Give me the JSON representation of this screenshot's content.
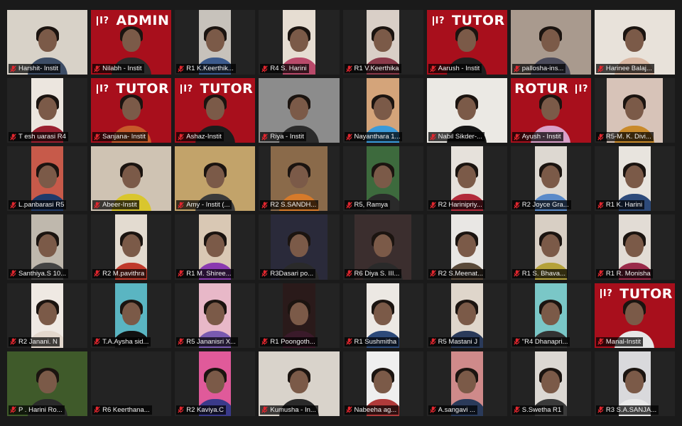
{
  "app": {
    "view": "gallery"
  },
  "colors": {
    "background": "#1a1a1a",
    "tile": "#232323",
    "brand_red": "#a80f1c",
    "mic_muted": "#e0262e"
  },
  "icons": {
    "name_badge_icon": "muted-mic-icon"
  },
  "participants": [
    {
      "name": "Harshit- Instit",
      "banner": "",
      "bg": "#d8d2c8",
      "shirt": "#3d4d66",
      "video": "full"
    },
    {
      "name": "Nilabh - Instit",
      "banner": "ADMIN",
      "bg": "#a80f1c",
      "shirt": "#2a2a2a",
      "video": "full"
    },
    {
      "name": "R1 K.Keerthik...",
      "banner": "",
      "bg": "#c7c2bb",
      "shirt": "#3b5a8c",
      "video": "narrow"
    },
    {
      "name": "R4   S. Harini",
      "banner": "",
      "bg": "#e6ddd2",
      "shirt": "#b94a6a",
      "video": "narrow"
    },
    {
      "name": "R1 V.Keerthika",
      "banner": "",
      "bg": "#d9cfc7",
      "shirt": "#8a3a4a",
      "video": "narrow"
    },
    {
      "name": "Aarush - Instit",
      "banner": "TUTOR",
      "bg": "#a80f1c",
      "shirt": "#1f1f1f",
      "video": "full"
    },
    {
      "name": "pallosha-ins...",
      "banner": "",
      "bg": "#a99a8e",
      "shirt": "#4a4a5a",
      "video": "full"
    },
    {
      "name": "Harinee Balaj...",
      "banner": "",
      "bg": "#e8e2da",
      "shirt": "#d9b7a2",
      "video": "full"
    },
    {
      "name": "T esh uarasi R4",
      "banner": "",
      "bg": "#ece6df",
      "shirt": "#9a2030",
      "video": "narrow"
    },
    {
      "name": "Sanjana- Instit",
      "banner": "TUTOR",
      "bg": "#a80f1c",
      "shirt": "#c75a2a",
      "video": "full"
    },
    {
      "name": "Ashaz-Instit",
      "banner": "TUTOR",
      "bg": "#a80f1c",
      "shirt": "#1c1c1c",
      "video": "full"
    },
    {
      "name": "Riya - Instit",
      "banner": "",
      "bg": "#8c8c8c",
      "shirt": "#2b2b2b",
      "video": "full"
    },
    {
      "name": "Nayanthara 1...",
      "banner": "",
      "bg": "#d4a47a",
      "shirt": "#3a9ad9",
      "video": "narrow"
    },
    {
      "name": "Nabil Sikder-...",
      "banner": "",
      "bg": "#ebe9e4",
      "shirt": "#151515",
      "video": "full"
    },
    {
      "name": "Ayush - Instit",
      "banner": "ROTUR",
      "bg": "#a80f1c",
      "shirt": "#d9a0c8",
      "video": "full"
    },
    {
      "name": "R5-M. K. Divi...",
      "banner": "",
      "bg": "#d7c3b8",
      "shirt": "#c98a2a",
      "video": "mid"
    },
    {
      "name": "L.panbarasi R5",
      "banner": "",
      "bg": "#c75a4a",
      "shirt": "#1f3a6a",
      "video": "narrow"
    },
    {
      "name": "Abeer-Instit",
      "banner": "",
      "bg": "#cfc3b3",
      "shirt": "#d9c62e",
      "video": "full"
    },
    {
      "name": "Amy - Instit (...",
      "banner": "",
      "bg": "#c2a36a",
      "shirt": "#3a3a3a",
      "video": "full"
    },
    {
      "name": "R2 S.SANDH...",
      "banner": "",
      "bg": "#8a6a4a",
      "shirt": "#d67a2a",
      "video": "mid"
    },
    {
      "name": "R5, Ramya",
      "banner": "",
      "bg": "#3d6a3d",
      "shirt": "#2a2a2a",
      "video": "narrow"
    },
    {
      "name": "R2 Harinipriy...",
      "banner": "",
      "bg": "#e6e1db",
      "shirt": "#b22a3a",
      "video": "narrow"
    },
    {
      "name": "R2 Joyce Gra...",
      "banner": "",
      "bg": "#ddd8d1",
      "shirt": "#5a8ac9",
      "video": "narrow"
    },
    {
      "name": "R1 K. Harini",
      "banner": "",
      "bg": "#e8e4de",
      "shirt": "#2d4a7a",
      "video": "narrow"
    },
    {
      "name": "Santhiya.S 10...",
      "banner": "",
      "bg": "#bfb8ad",
      "shirt": "#444",
      "video": "narrow"
    },
    {
      "name": "R2 M.pavithra",
      "banner": "",
      "bg": "#e3dbd0",
      "shirt": "#c0392b",
      "video": "narrow"
    },
    {
      "name": "R1 M. Shiree...",
      "banner": "",
      "bg": "#d9c8b4",
      "shirt": "#8a3ab0",
      "video": "narrow"
    },
    {
      "name": "R3Dasari po...",
      "banner": "",
      "bg": "#2a2a3a",
      "shirt": "#2a2a2a",
      "video": "mid"
    },
    {
      "name": "R6 Diya S. III...",
      "banner": "",
      "bg": "#3b2e2e",
      "shirt": "#2a2a2a",
      "video": "mid"
    },
    {
      "name": "R2 S.Meenat...",
      "banner": "",
      "bg": "#e9e7e4",
      "shirt": "#5a4a3a",
      "video": "narrow"
    },
    {
      "name": "R1 S. Bhava...",
      "banner": "",
      "bg": "#d8cfc4",
      "shirt": "#b5a23a",
      "video": "narrow"
    },
    {
      "name": "R1 R. Monisha",
      "banner": "",
      "bg": "#e2dcd5",
      "shirt": "#9a2a4a",
      "video": "narrow"
    },
    {
      "name": "R2 Janani. N",
      "banner": "",
      "bg": "#efe9e3",
      "shirt": "#e3d8cd",
      "video": "narrow"
    },
    {
      "name": "T.A.Aysha sid...",
      "banner": "",
      "bg": "#5ab5c2",
      "shirt": "#111",
      "video": "narrow"
    },
    {
      "name": "R5 Jananisri X...",
      "banner": "",
      "bg": "#e8b8c8",
      "shirt": "#7a5ab0",
      "video": "narrow"
    },
    {
      "name": "R1 Poongoth...",
      "banner": "",
      "bg": "#2a1a1a",
      "shirt": "#3a1a2a",
      "video": "narrow"
    },
    {
      "name": "R1 Sushmitha",
      "banner": "",
      "bg": "#ece8e3",
      "shirt": "#2d4a7a",
      "video": "narrow"
    },
    {
      "name": "R5 Mastani J",
      "banner": "",
      "bg": "#dfd6cb",
      "shirt": "#2a3a5a",
      "video": "narrow"
    },
    {
      "name": "\"R4 Dhanapri...",
      "banner": "",
      "bg": "#7ac7c7",
      "shirt": "#333",
      "video": "narrow"
    },
    {
      "name": "Manal-Instit",
      "banner": "TUTOR",
      "bg": "#a80f1c",
      "shirt": "#e6e6e6",
      "video": "full"
    },
    {
      "name": "P . Harini Ro...",
      "banner": "",
      "bg": "#3f5a2a",
      "shirt": "#2a2a2a",
      "video": "full"
    },
    {
      "name": "R6 Keerthana...",
      "banner": "",
      "bg": "#232323",
      "shirt": "#232323",
      "video": "none"
    },
    {
      "name": "R2 Kaviya.C",
      "banner": "",
      "bg": "#e05a9a",
      "shirt": "#3a3a8a",
      "video": "narrow"
    },
    {
      "name": "Kumusha - In...",
      "banner": "",
      "bg": "#d9d3cb",
      "shirt": "#2a2a2a",
      "video": "full"
    },
    {
      "name": "Nabeeha ag...",
      "banner": "",
      "bg": "#efefef",
      "shirt": "#b03a3a",
      "video": "narrow"
    },
    {
      "name": "A.sangavi ...",
      "banner": "",
      "bg": "#cf8a8a",
      "shirt": "#2a3a5a",
      "video": "narrow"
    },
    {
      "name": "S.Swetha R1",
      "banner": "",
      "bg": "#dcd8d3",
      "shirt": "#3a3a3a",
      "video": "narrow"
    },
    {
      "name": "R3 S.A.SANJA...",
      "banner": "",
      "bg": "#d9d9dc",
      "shirt": "#e9e9e9",
      "video": "narrow"
    }
  ]
}
